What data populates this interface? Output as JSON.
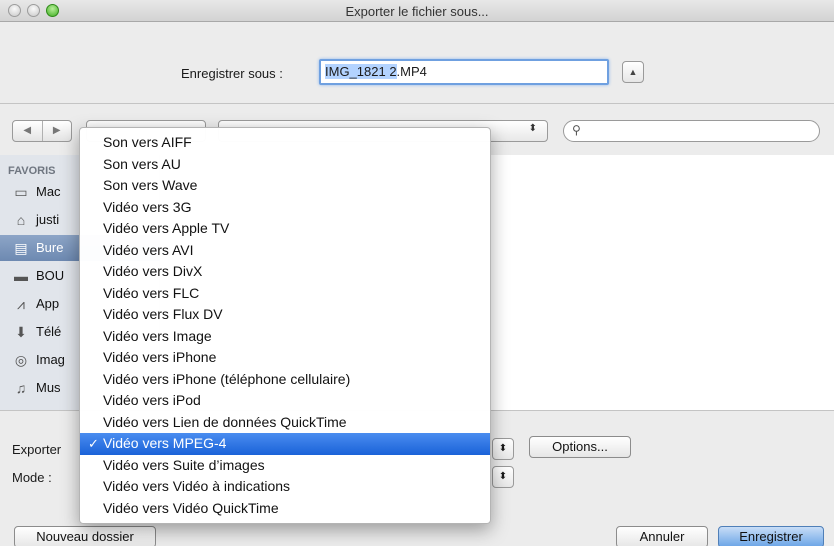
{
  "window": {
    "title": "Exporter le fichier sous..."
  },
  "save": {
    "label": "Enregistrer sous :",
    "filename_selected": "IMG_1821 2",
    "filename_ext": ".MP4",
    "expand_icon": "chevron-up-icon"
  },
  "toolbar": {
    "back_icon": "◀",
    "forward_icon": "▶",
    "search_icon": "magnifier-icon",
    "popup_arrows": "⬍"
  },
  "sidebar": {
    "header": "FAVORIS",
    "items": [
      {
        "label": "Mac",
        "icon": "hard-drive-icon",
        "glyph": "▭"
      },
      {
        "label": "justi",
        "icon": "home-icon",
        "glyph": "⌂"
      },
      {
        "label": "Bure",
        "icon": "desktop-icon",
        "glyph": "▤",
        "selected": true
      },
      {
        "label": "BOU",
        "icon": "folder-icon",
        "glyph": "▬"
      },
      {
        "label": "App",
        "icon": "applications-icon",
        "glyph": "⩘"
      },
      {
        "label": "Télé",
        "icon": "downloads-icon",
        "glyph": "⬇"
      },
      {
        "label": "Imag",
        "icon": "camera-icon",
        "glyph": "◎"
      },
      {
        "label": "Mus",
        "icon": "music-icon",
        "glyph": "♫"
      }
    ]
  },
  "bottom": {
    "export_label": "Exporter",
    "mode_label": "Mode :",
    "options_label": "Options...",
    "new_folder_label": "Nouveau dossier",
    "cancel_label": "Annuler",
    "save_label": "Enregistrer",
    "popup_arrows": "⬍"
  },
  "menu": {
    "check_glyph": "✓",
    "items": [
      {
        "label": "Son vers AIFF"
      },
      {
        "label": "Son vers AU"
      },
      {
        "label": "Son vers Wave"
      },
      {
        "label": "Vidéo vers 3G"
      },
      {
        "label": "Vidéo vers Apple TV"
      },
      {
        "label": "Vidéo vers AVI"
      },
      {
        "label": "Vidéo vers DivX"
      },
      {
        "label": "Vidéo vers FLC"
      },
      {
        "label": "Vidéo vers Flux DV"
      },
      {
        "label": "Vidéo vers Image"
      },
      {
        "label": "Vidéo vers iPhone"
      },
      {
        "label": "Vidéo vers iPhone (téléphone cellulaire)"
      },
      {
        "label": "Vidéo vers iPod"
      },
      {
        "label": "Vidéo vers Lien de données QuickTime"
      },
      {
        "label": "Vidéo vers MPEG-4",
        "selected": true
      },
      {
        "label": "Vidéo vers Suite d’images"
      },
      {
        "label": "Vidéo vers Vidéo à indications"
      },
      {
        "label": "Vidéo vers Vidéo QuickTime"
      }
    ]
  }
}
